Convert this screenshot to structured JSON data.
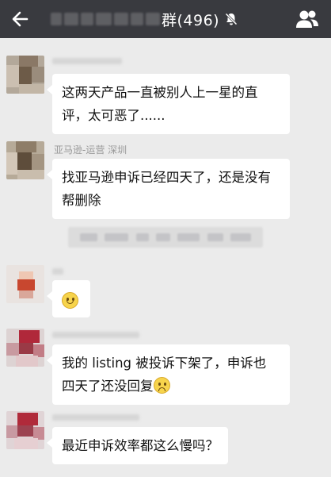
{
  "header": {
    "title_suffix": "群(496)",
    "back_icon": "back-arrow-icon",
    "mute_icon": "bell-muted-icon",
    "members_icon": "group-members-icon",
    "bar_color": "#393a3f"
  },
  "messages": [
    {
      "sender": "",
      "text": "这两天产品一直被别人上一星的直评，太可恶了......",
      "line1": "这两天产品一直被别人上一星的直",
      "line2": "评，太可恶了......"
    },
    {
      "sender": "亚马逊-运营 深圳",
      "line1": "找亚马逊申诉已经四天了，还是没有",
      "line2": "帮删除"
    },
    {
      "sender": "",
      "emoji": "smile-emoji"
    },
    {
      "sender": "",
      "line1": "我的 listing 被投诉下架了，申诉也",
      "line2": "四天了还没回复",
      "emoji": "sad-emoji"
    },
    {
      "sender": "",
      "line1": "最近申诉效率都这么慢吗？"
    }
  ],
  "colors": {
    "background": "#ebebeb",
    "bubble": "#ffffff",
    "sender_text": "#999999"
  }
}
